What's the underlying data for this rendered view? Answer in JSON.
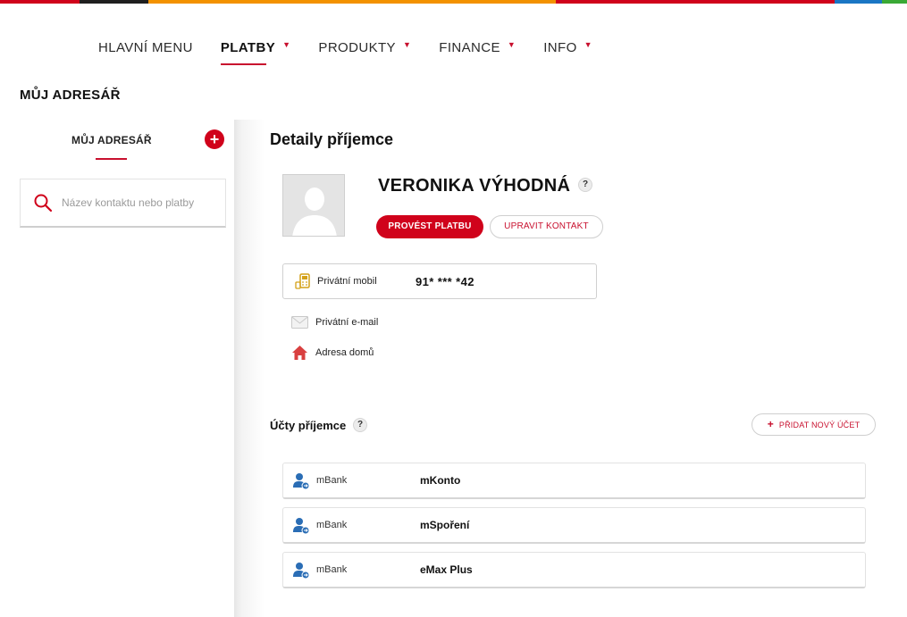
{
  "brand_colors": {
    "stripe": [
      "#d0021b",
      "#1f1f1f",
      "#f39200",
      "#d0021b",
      "#1a76c4",
      "#3aa935"
    ],
    "accent": "#d0021b"
  },
  "nav": {
    "items": [
      {
        "label": "HLAVNÍ MENU",
        "has_dropdown": false,
        "active": false
      },
      {
        "label": "PLATBY",
        "has_dropdown": true,
        "active": true
      },
      {
        "label": "PRODUKTY",
        "has_dropdown": true,
        "active": false
      },
      {
        "label": "FINANCE",
        "has_dropdown": true,
        "active": false
      },
      {
        "label": "INFO",
        "has_dropdown": true,
        "active": false
      }
    ]
  },
  "page_title": "MŮJ ADRESÁŘ",
  "sidebar": {
    "title": "MŮJ ADRESÁŘ",
    "add_icon": "plus-icon",
    "search_placeholder": "Název kontaktu nebo platby",
    "search_icon": "search-icon"
  },
  "details": {
    "title": "Detaily příjemce",
    "contact_name": "VERONIKA VÝHODNÁ",
    "help_label": "?",
    "pay_button": "PROVÉST PLATBU",
    "edit_button": "UPRAVIT KONTAKT",
    "phone": {
      "icon": "mobile-phone-icon",
      "label": "Privátní mobil",
      "value": "91* *** *42"
    },
    "email": {
      "icon": "envelope-icon",
      "label": "Privátní e-mail"
    },
    "address": {
      "icon": "home-icon",
      "label": "Adresa domů"
    }
  },
  "accounts": {
    "title": "Účty příjemce",
    "help_label": "?",
    "add_button": "PŘIDAT NOVÝ ÚČET",
    "items": [
      {
        "bank": "mBank",
        "name": "mKonto",
        "icon": "person-account-icon"
      },
      {
        "bank": "mBank",
        "name": "mSpoření",
        "icon": "person-account-icon"
      },
      {
        "bank": "mBank",
        "name": "eMax Plus",
        "icon": "person-account-icon"
      }
    ]
  }
}
